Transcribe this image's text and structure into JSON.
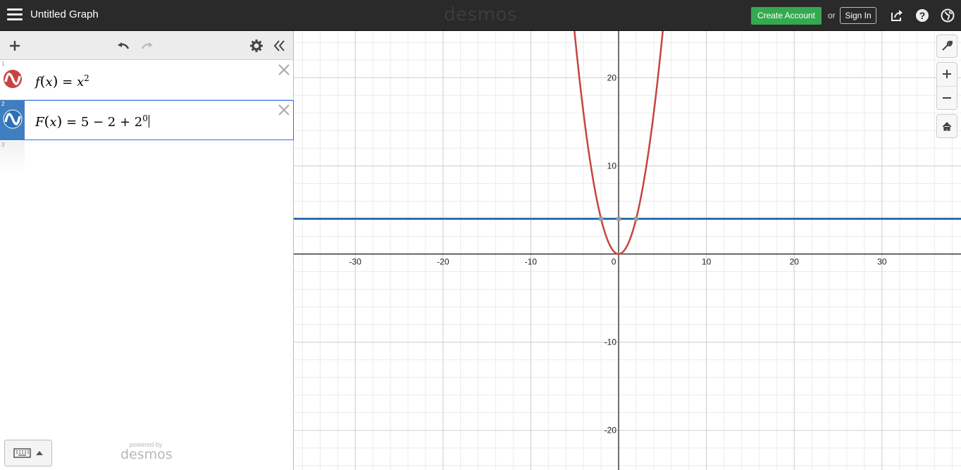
{
  "header": {
    "title": "Untitled Graph",
    "logo": "desmos",
    "create_account": "Create Account",
    "or": "or",
    "sign_in": "Sign In"
  },
  "expressions": [
    {
      "number": "1",
      "color": "#c74440",
      "lhs_fn": "f",
      "arg": "x",
      "rhs": "x",
      "rhs_sup": "2"
    },
    {
      "number": "2",
      "color": "#2d70b3",
      "lhs_fn": "F",
      "rhs": "5 − 2 + 2",
      "rhs_sup": "0",
      "selected": true
    },
    {
      "number": "3"
    }
  ],
  "footer": {
    "powered_by": "powered by",
    "brand": "desmos"
  },
  "graph": {
    "x_ticks": [
      "-30",
      "-20",
      "-10",
      "0",
      "10",
      "20",
      "30"
    ],
    "y_ticks": [
      "20",
      "10",
      "-10",
      "-20"
    ],
    "x_range": [
      -37,
      39
    ],
    "y_range": [
      -24.5,
      25.3
    ],
    "curve_color": "#c74440",
    "line_color": "#2d70b3",
    "horizontal_line_y": 4
  },
  "icons": {
    "menu": "hamburger-icon",
    "add": "plus-icon",
    "undo": "undo-icon",
    "redo": "redo-icon",
    "settings": "gear-icon",
    "collapse": "double-chevron-left-icon",
    "share": "share-icon",
    "help": "help-icon",
    "language": "globe-icon",
    "wrench": "wrench-icon",
    "zoom_in": "zoom-in-icon",
    "zoom_out": "zoom-out-icon",
    "home": "home-icon",
    "keyboard": "keyboard-icon",
    "delete": "close-icon"
  }
}
